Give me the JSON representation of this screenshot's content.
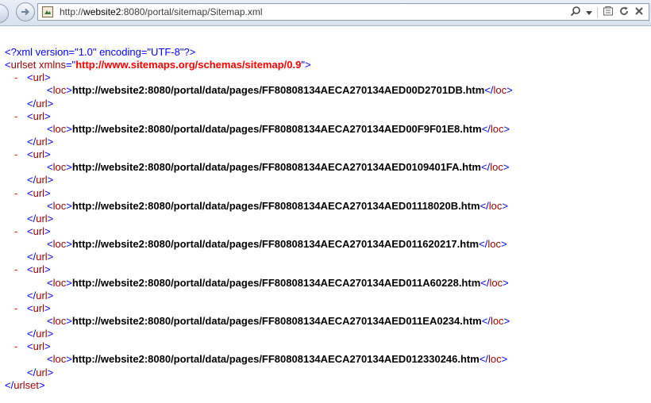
{
  "browser": {
    "address_prefix": "http://",
    "address_domain": "website2",
    "address_rest": ":8080/portal/sitemap/Sitemap.xml"
  },
  "xml": {
    "declaration": "<?xml version=\"1.0\" encoding=\"UTF-8\"?>",
    "root_tag": "urlset",
    "root_attr_name": "xmlns",
    "root_attr_value": "http://www.sitemaps.org/schemas/sitemap/0.9",
    "child_tag": "url",
    "loc_tag": "loc",
    "collapse_symbol": "-",
    "locs": [
      "http://website2:8080/portal/data/pages/FF80808134AECA270134AED00D2701DB.htm",
      "http://website2:8080/portal/data/pages/FF80808134AECA270134AED00F9F01E8.htm",
      "http://website2:8080/portal/data/pages/FF80808134AECA270134AED0109401FA.htm",
      "http://website2:8080/portal/data/pages/FF80808134AECA270134AED01118020B.htm",
      "http://website2:8080/portal/data/pages/FF80808134AECA270134AED011620217.htm",
      "http://website2:8080/portal/data/pages/FF80808134AECA270134AED011A60228.htm",
      "http://website2:8080/portal/data/pages/FF80808134AECA270134AED011EA0234.htm",
      "http://website2:8080/portal/data/pages/FF80808134AECA270134AED012330246.htm"
    ]
  }
}
